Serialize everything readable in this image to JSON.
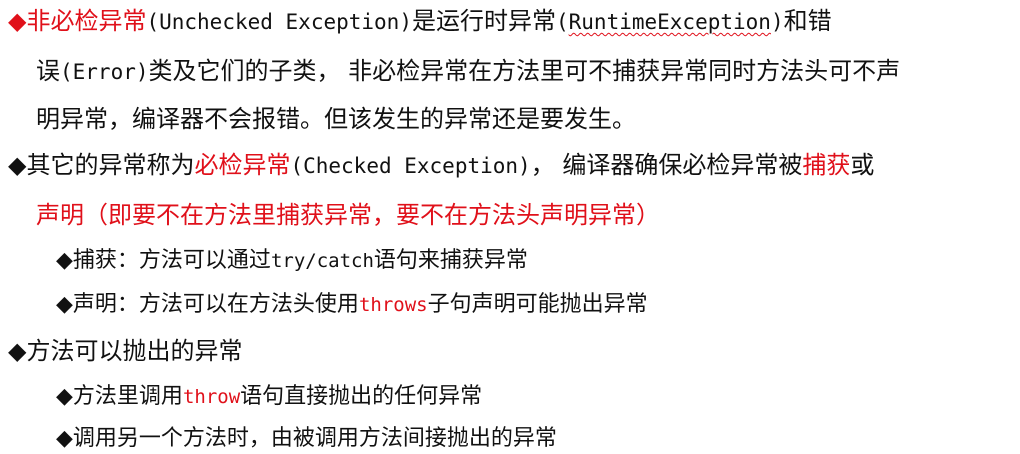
{
  "bullet_glyph": "◆",
  "colors": {
    "text": "#111111",
    "highlight": "#e0101a",
    "background": "#ffffff"
  },
  "items": [
    {
      "p1": "非必检异常",
      "p2": "(Unchecked Exception)",
      "p3": "是运行时异常",
      "p4": "(",
      "p5": "RuntimeException",
      "p6": ")",
      "p7": "和错",
      "l2a": "误",
      "l2b": "(Error)",
      "l2c": "类及它们的子类， 非必检异常在方法里可不捕获异常同时方法头可不声",
      "l3": "明异常，编译器不会报错。但该发生的异常还是要发生。"
    },
    {
      "p1": "其它的异常称为",
      "p2": "必检异常",
      "p3": "(Checked Exception)",
      "p4": "， 编译器确保必检异常被",
      "p5": "捕获",
      "p6": "或",
      "l2": "声明（即要不在方法里捕获异常，要不在方法头声明异常）",
      "subs": [
        {
          "a": "捕获：方法可以通过",
          "b": "try/catch",
          "c": "语句来捕获异常"
        },
        {
          "a": "声明：方法可以在方法头使用",
          "b": "throws",
          "c": "子句声明可能抛出异常"
        }
      ]
    },
    {
      "p1": "方法可以抛出的异常",
      "subs": [
        {
          "a": "方法里调用",
          "b": "throw",
          "c": "语句直接抛出的任何异常"
        },
        {
          "a": "调用另一个方法时，由被调用方法间接抛出的异常"
        }
      ]
    }
  ]
}
